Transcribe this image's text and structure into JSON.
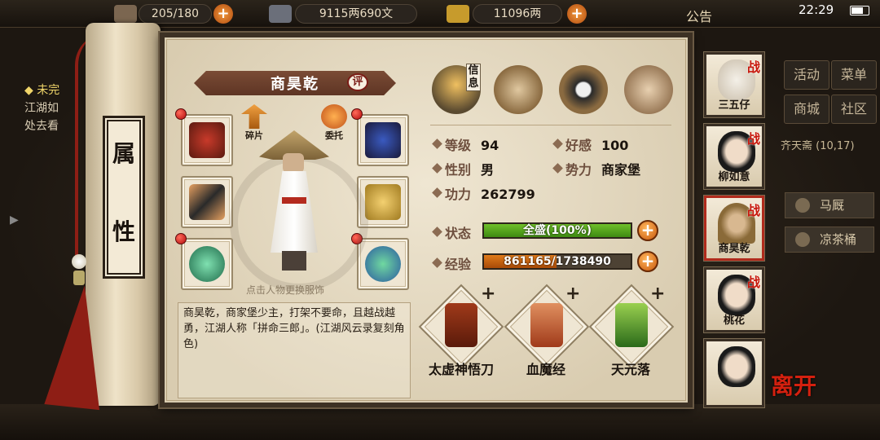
{
  "status_bar": {
    "time": "22:29"
  },
  "top_resources": {
    "bag_label": "背包",
    "bag_count": "205/180",
    "silver": "9115两690文",
    "gold": "11096两",
    "notice": "公告"
  },
  "left_quest": {
    "title": "未完",
    "line1": "江湖如",
    "line2": "处去看"
  },
  "right_menu": {
    "buttons": [
      "活动",
      "菜单",
      "商城",
      "社区"
    ],
    "location": "齐天斋",
    "coords": "(10,17)",
    "items": [
      "马厩",
      "凉茶桶"
    ]
  },
  "scroll_tab": {
    "char1": "属",
    "char2": "性"
  },
  "character": {
    "name": "商昊乾",
    "rate_label": "评",
    "fragment_label": "碎片",
    "entrust_label": "委托",
    "hint": "点击人物更换服饰",
    "description": "商昊乾，商家堡少主，打架不要命，且越战越勇，江湖人称「拼命三郎」。(江湖风云录复刻角色)"
  },
  "tabs": {
    "info_label_1": "信",
    "info_label_2": "息"
  },
  "attributes": {
    "level_label": "等级",
    "level_value": "94",
    "favor_label": "好感",
    "favor_value": "100",
    "gender_label": "性别",
    "gender_value": "男",
    "faction_label": "势力",
    "faction_value": "商家堡",
    "power_label": "功力",
    "power_value": "262799",
    "state_label": "状态",
    "state_value": "全盛(100%)",
    "state_fraction": 1.0,
    "exp_label": "经验",
    "exp_value": "861165/1738490",
    "exp_fraction": 0.495
  },
  "skills": [
    {
      "name": "太虚神悟刀"
    },
    {
      "name": "血魔经"
    },
    {
      "name": "天元落"
    }
  ],
  "team": [
    {
      "name": "三五仔",
      "tag": "战"
    },
    {
      "name": "柳如意",
      "tag": "战"
    },
    {
      "name": "商昊乾",
      "tag": "战"
    },
    {
      "name": "桃花",
      "tag": "战"
    },
    {
      "name": ""
    }
  ],
  "leave_label": "离开",
  "colors": {
    "state_bar": "#6fbf2a",
    "exp_bar": "#e07a1a",
    "accent_red": "#b02a1c"
  }
}
